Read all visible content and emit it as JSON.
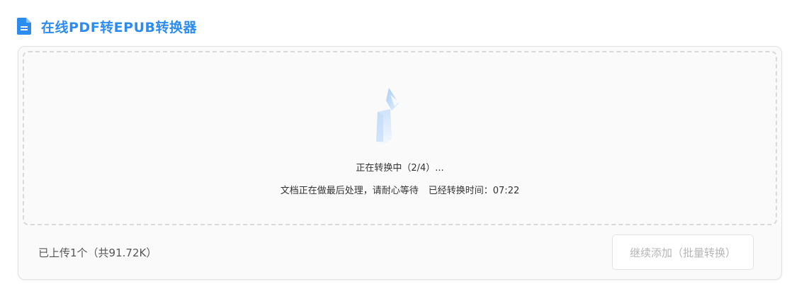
{
  "header": {
    "icon": "document-icon",
    "title": "在线PDF转EPUB转换器",
    "accent_color": "#2d8cf0"
  },
  "converter": {
    "loader_icon": "converting-spinner-icon",
    "status_main": "正在转换中（2/4）...",
    "status_note": "文档正在做最后处理，请耐心等待",
    "elapsed_label": "已经转换时间：07:22"
  },
  "footer": {
    "upload_summary": "已上传1个（共91.72K）",
    "continue_button_label": "继续添加（批量转换）"
  }
}
